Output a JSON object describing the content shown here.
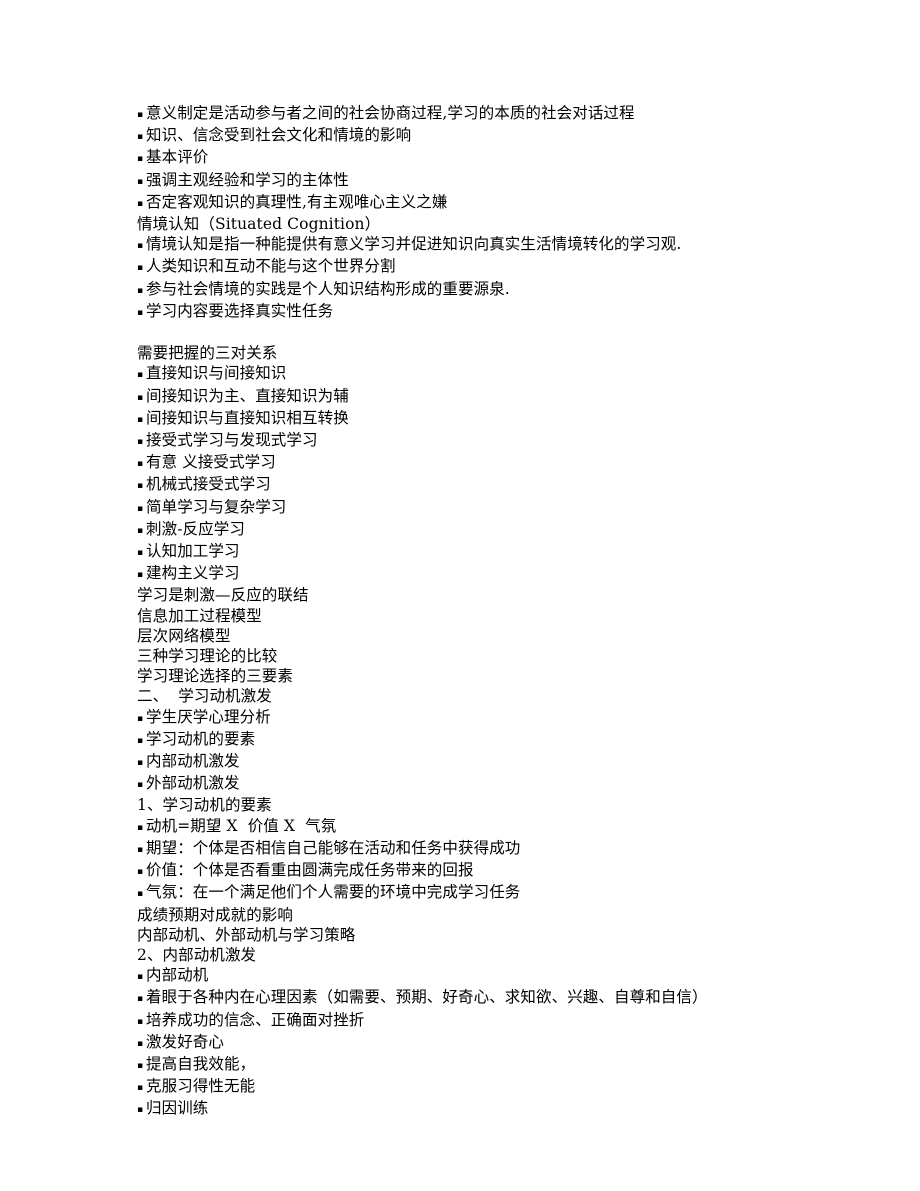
{
  "document": {
    "page_background": "#ffffff",
    "text_color": "#000000",
    "bullet_glyph": "▪",
    "lines": [
      {
        "bullet": true,
        "text": "意义制定是活动参与者之间的社会协商过程,学习的本质的社会对话过程"
      },
      {
        "bullet": true,
        "text": "知识、信念受到社会文化和情境的影响"
      },
      {
        "bullet": true,
        "text": "基本评价"
      },
      {
        "bullet": true,
        "text": "强调主观经验和学习的主体性"
      },
      {
        "bullet": true,
        "text": "否定客观知识的真理性,有主观唯心主义之嫌"
      },
      {
        "bullet": false,
        "text": "情境认知（Situated Cognition）"
      },
      {
        "bullet": true,
        "text": "情境认知是指一种能提供有意义学习并促进知识向真实生活情境转化的学习观."
      },
      {
        "bullet": true,
        "text": "人类知识和互动不能与这个世界分割"
      },
      {
        "bullet": true,
        "text": "参与社会情境的实践是个人知识结构形成的重要源泉."
      },
      {
        "bullet": true,
        "text": "学习内容要选择真实性任务"
      },
      {
        "bullet": false,
        "text": ""
      },
      {
        "bullet": false,
        "text": "需要把握的三对关系"
      },
      {
        "bullet": true,
        "text": "直接知识与间接知识"
      },
      {
        "bullet": true,
        "text": "间接知识为主、直接知识为辅"
      },
      {
        "bullet": true,
        "text": "间接知识与直接知识相互转换"
      },
      {
        "bullet": true,
        "text": "接受式学习与发现式学习"
      },
      {
        "bullet": true,
        "text": "有意 义接受式学习"
      },
      {
        "bullet": true,
        "text": "机械式接受式学习"
      },
      {
        "bullet": true,
        "text": "简单学习与复杂学习"
      },
      {
        "bullet": true,
        "text": "刺激-反应学习"
      },
      {
        "bullet": true,
        "text": "认知加工学习"
      },
      {
        "bullet": true,
        "text": "建构主义学习"
      },
      {
        "bullet": false,
        "text": "学习是刺激—反应的联结"
      },
      {
        "bullet": false,
        "text": "信息加工过程模型"
      },
      {
        "bullet": false,
        "text": "层次网络模型"
      },
      {
        "bullet": false,
        "text": "三种学习理论的比较"
      },
      {
        "bullet": false,
        "text": "学习理论选择的三要素"
      },
      {
        "bullet": false,
        "text": "二、  学习动机激发"
      },
      {
        "bullet": true,
        "text": "学生厌学心理分析"
      },
      {
        "bullet": true,
        "text": "学习动机的要素"
      },
      {
        "bullet": true,
        "text": "内部动机激发"
      },
      {
        "bullet": true,
        "text": "外部动机激发"
      },
      {
        "bullet": false,
        "text": "1、学习动机的要素"
      },
      {
        "bullet": true,
        "text": "动机=期望 X  价值 X  气氛"
      },
      {
        "bullet": true,
        "text": "期望：个体是否相信自己能够在活动和任务中获得成功"
      },
      {
        "bullet": true,
        "text": "价值：个体是否看重由圆满完成任务带来的回报"
      },
      {
        "bullet": true,
        "text": "气氛：在一个满足他们个人需要的环境中完成学习任务"
      },
      {
        "bullet": false,
        "text": "成绩预期对成就的影响"
      },
      {
        "bullet": false,
        "text": "内部动机、外部动机与学习策略"
      },
      {
        "bullet": false,
        "text": "2、内部动机激发"
      },
      {
        "bullet": true,
        "text": "内部动机"
      },
      {
        "bullet": true,
        "text": "着眼于各种内在心理因素（如需要、预期、好奇心、求知欲、兴趣、自尊和自信）"
      },
      {
        "bullet": true,
        "text": "培养成功的信念、正确面对挫折"
      },
      {
        "bullet": true,
        "text": "激发好奇心"
      },
      {
        "bullet": true,
        "text": "提高自我效能，"
      },
      {
        "bullet": true,
        "text": "克服习得性无能"
      },
      {
        "bullet": true,
        "text": "归因训练"
      }
    ]
  }
}
